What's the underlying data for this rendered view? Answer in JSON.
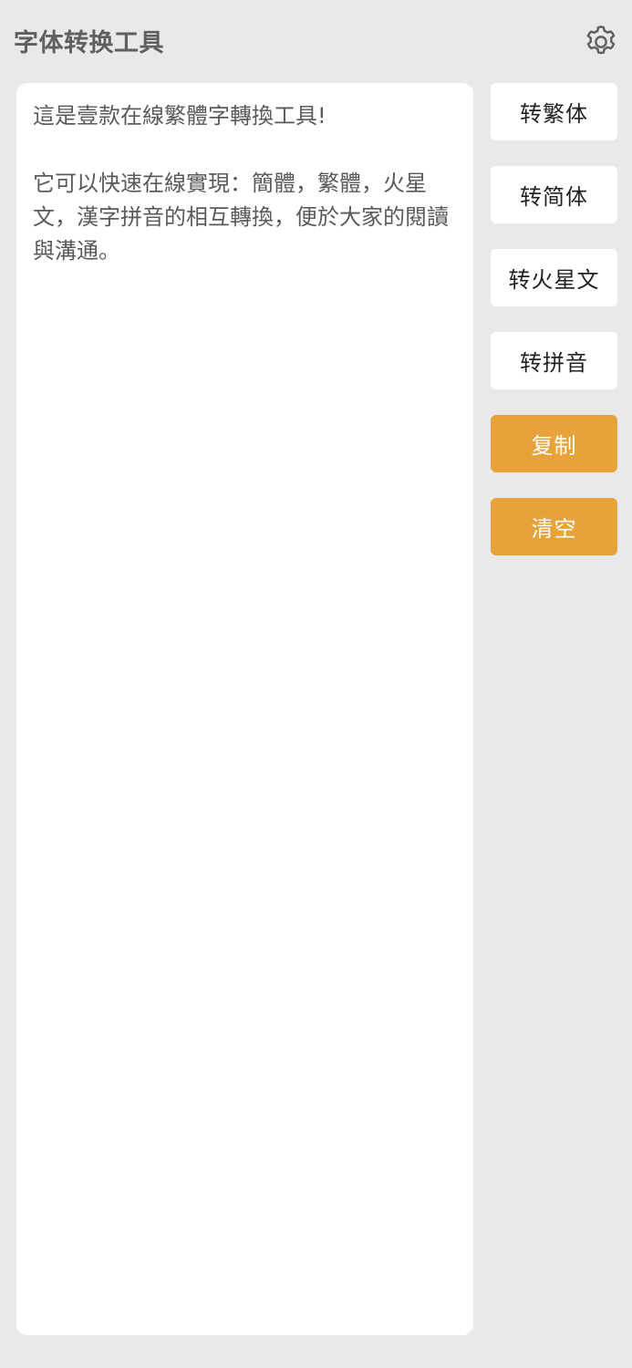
{
  "header": {
    "title": "字体转换工具",
    "settings_icon": "gear-icon"
  },
  "editor": {
    "text": "這是壹款在線繁體字轉換工具!\n\n它可以快速在線實現：簡體，繁體，火星文，漢字拼音的相互轉換，便於大家的閱讀與溝通。"
  },
  "buttons": {
    "to_traditional": "转繁体",
    "to_simplified": "转简体",
    "to_martian": "转火星文",
    "to_pinyin": "转拼音",
    "copy": "复制",
    "clear": "清空"
  },
  "colors": {
    "background": "#e9e9eb",
    "panel": "#ffffff",
    "accent": "#e8a23a",
    "title": "#5f5f5f"
  }
}
